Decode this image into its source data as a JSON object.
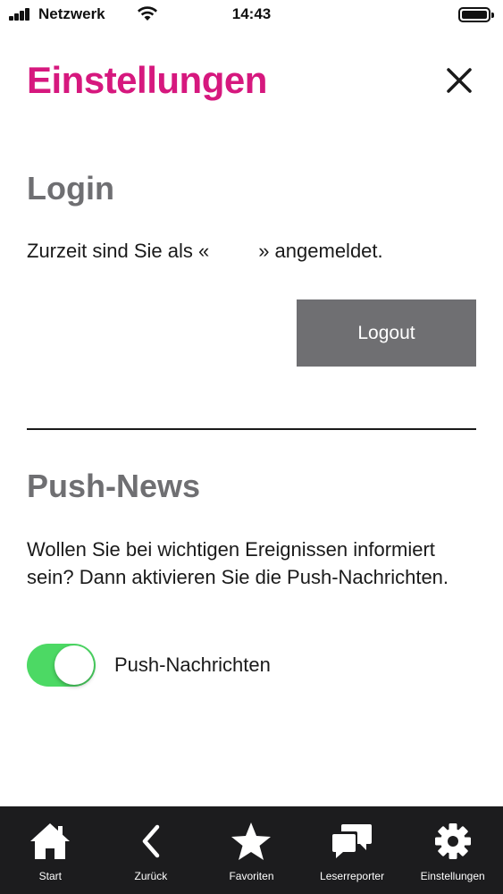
{
  "status_bar": {
    "carrier": "Netzwerk",
    "time": "14:43"
  },
  "header": {
    "title": "Einstellungen"
  },
  "login": {
    "title": "Login",
    "status_text": "Zurzeit sind Sie als «         » angemeldet.",
    "logout_label": "Logout"
  },
  "push": {
    "title": "Push-News",
    "description": "Wollen Sie bei wichtigen Ereignissen informiert sein? Dann aktivieren Sie die Push-Nachrichten.",
    "toggle_label": "Push-Nachrichten",
    "toggle_on": true,
    "toggle_color": "#4cd964"
  },
  "accent_color": "#d6187e",
  "tabbar": {
    "items": [
      {
        "label": "Start",
        "icon": "home-icon"
      },
      {
        "label": "Zurück",
        "icon": "chevron-left-icon"
      },
      {
        "label": "Favoriten",
        "icon": "star-icon"
      },
      {
        "label": "Leserreporter",
        "icon": "chat-bubbles-icon"
      },
      {
        "label": "Einstellungen",
        "icon": "gear-icon"
      }
    ]
  }
}
